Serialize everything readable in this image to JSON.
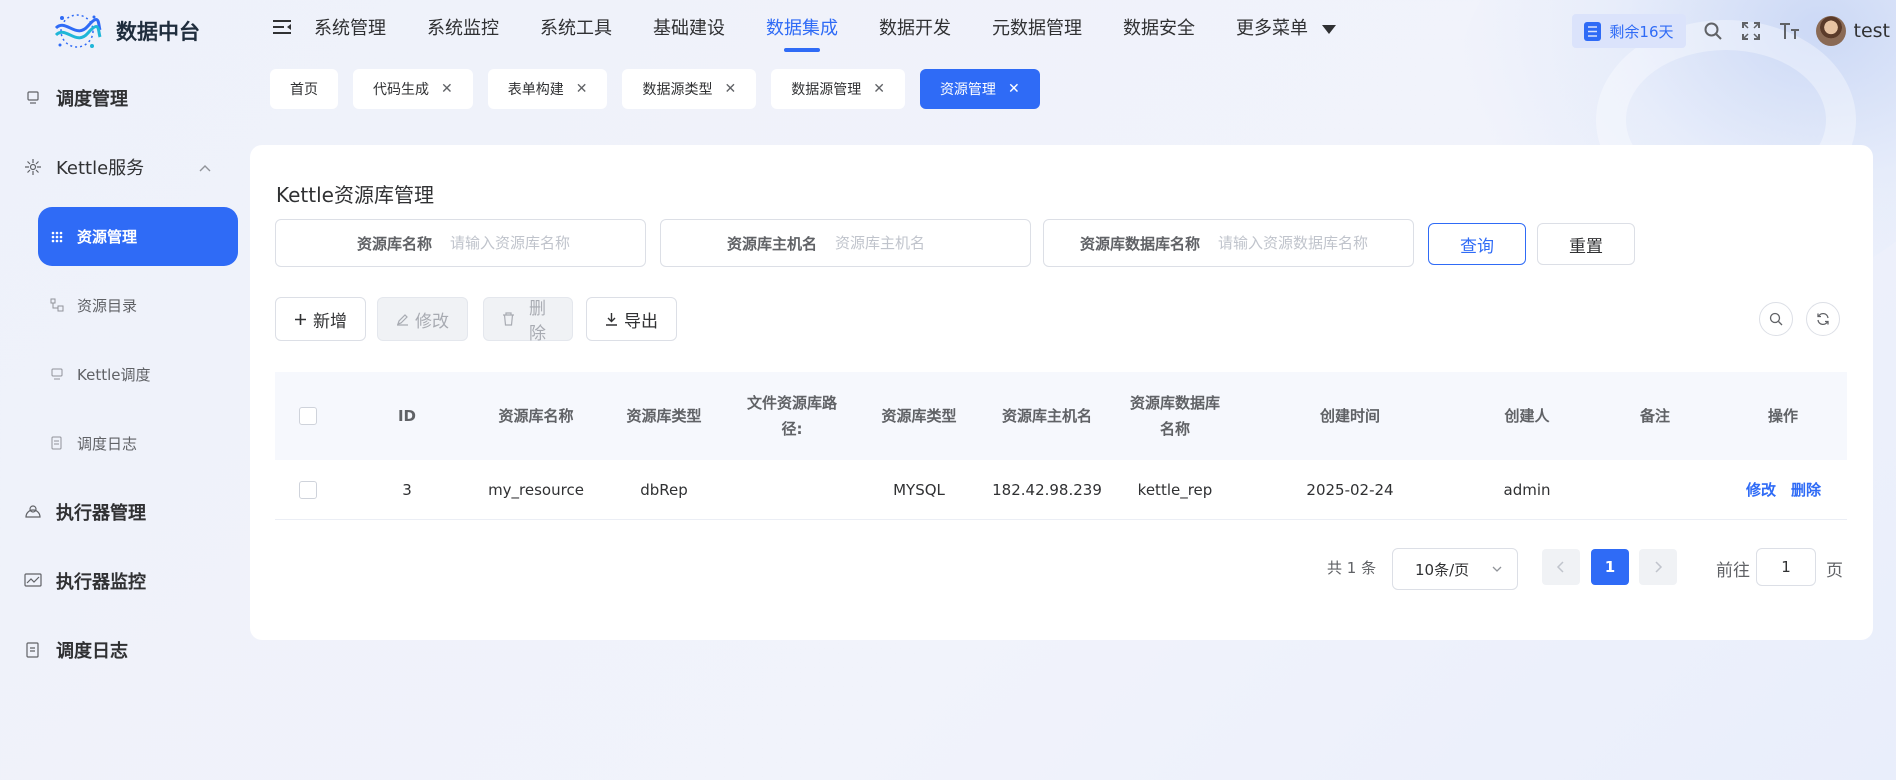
{
  "app": {
    "title": "数据中台"
  },
  "sidebar": {
    "items": [
      {
        "label": "调度管理"
      },
      {
        "label": "Kettle服务"
      },
      {
        "label": "执行器管理"
      },
      {
        "label": "执行器监控"
      },
      {
        "label": "调度日志"
      }
    ],
    "sub_items": [
      {
        "label": "资源管理"
      },
      {
        "label": "资源目录"
      },
      {
        "label": "Kettle调度"
      },
      {
        "label": "调度日志"
      }
    ]
  },
  "topnav": {
    "items": [
      "系统管理",
      "系统监控",
      "系统工具",
      "基础建设",
      "数据集成",
      "数据开发",
      "元数据管理",
      "数据安全",
      "更多菜单"
    ],
    "active": "数据集成"
  },
  "header": {
    "license_badge": "剩余16天",
    "username": "test"
  },
  "tabs": [
    {
      "label": "首页"
    },
    {
      "label": "代码生成"
    },
    {
      "label": "表单构建"
    },
    {
      "label": "数据源类型"
    },
    {
      "label": "数据源管理"
    },
    {
      "label": "资源管理"
    }
  ],
  "page": {
    "title": "Kettle资源库管理",
    "search": {
      "name_label": "资源库名称",
      "name_placeholder": "请输入资源库名称",
      "host_label": "资源库主机名",
      "host_placeholder": "资源库主机名",
      "db_label": "资源库数据库名称",
      "db_placeholder": "请输入资源数据库名称",
      "query": "查询",
      "reset": "重置"
    },
    "toolbar": {
      "add": "新增",
      "edit": "修改",
      "delete": "删除",
      "export": "导出"
    }
  },
  "table": {
    "headers": {
      "id": "ID",
      "name": "资源库名称",
      "type": "资源库类型",
      "path_1": "文件资源库路",
      "path_2": "径:",
      "db_type": "资源库类型",
      "host": "资源库主机名",
      "dbname_1": "资源库数据库",
      "dbname_2": "名称",
      "created": "创建时间",
      "creator": "创建人",
      "remark": "备注",
      "actions": "操作"
    },
    "rows": [
      {
        "id": "3",
        "name": "my_resource",
        "type": "dbRep",
        "path": "",
        "db_type": "MYSQL",
        "host": "182.42.98.239",
        "dbname": "kettle_rep",
        "created": "2025-02-24",
        "creator": "admin",
        "remark": "",
        "edit": "修改",
        "delete": "删除"
      }
    ]
  },
  "pagination": {
    "total": "共 1 条",
    "page_size": "10条/页",
    "current": "1",
    "goto_label": "前往",
    "goto_value": "1",
    "page_suffix": "页"
  }
}
